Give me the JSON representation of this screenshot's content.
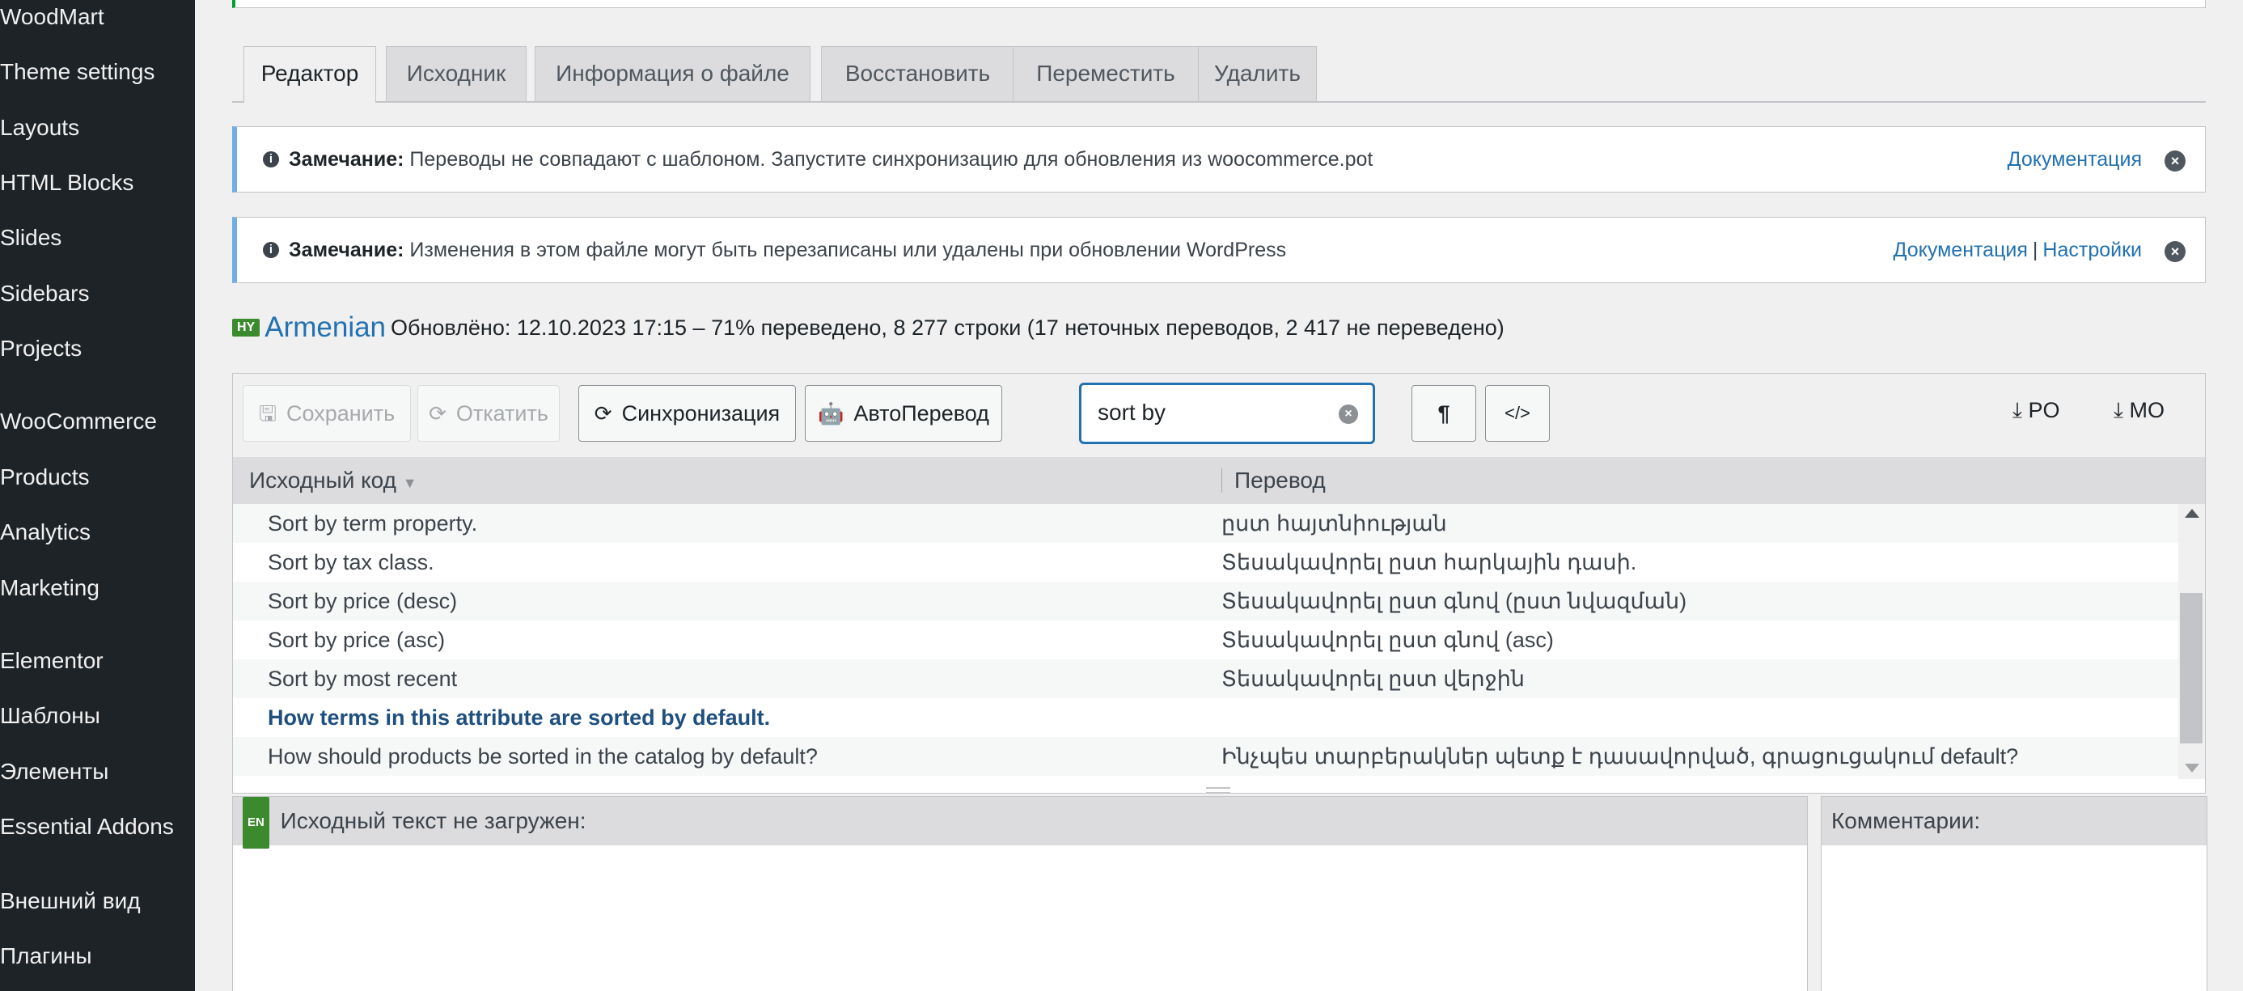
{
  "sidebar": {
    "items": [
      {
        "label": "WoodMart"
      },
      {
        "label": "Theme settings"
      },
      {
        "label": "Layouts"
      },
      {
        "label": "HTML Blocks"
      },
      {
        "label": "Slides"
      },
      {
        "label": "Sidebars"
      },
      {
        "label": "Projects"
      },
      {
        "label": "WooCommerce"
      },
      {
        "label": "Products"
      },
      {
        "label": "Analytics"
      },
      {
        "label": "Marketing"
      },
      {
        "label": "Elementor"
      },
      {
        "label": "Шаблоны"
      },
      {
        "label": "Элементы"
      },
      {
        "label": "Essential Addons"
      },
      {
        "label": "Внешний вид"
      },
      {
        "label": "Плагины"
      }
    ]
  },
  "tabs": [
    {
      "label": "Редактор",
      "active": true
    },
    {
      "label": "Исходник"
    },
    {
      "label": "Информация о файле"
    },
    {
      "label": "Восстановить"
    },
    {
      "label": "Переместить"
    },
    {
      "label": "Удалить"
    }
  ],
  "notices": [
    {
      "prefix": "Замечание:",
      "text": "Переводы не совпадают с шаблоном. Запустите синхронизацию для обновления из woocommerce.pot",
      "link1": "Документация"
    },
    {
      "prefix": "Замечание:",
      "text": "Изменения в этом файле могут быть перезаписаны или удалены при обновлении WordPress",
      "link1": "Документация",
      "separator": "|",
      "link2": "Настройки"
    }
  ],
  "locale": {
    "flag": "HY",
    "name": "Armenian",
    "stats": "Обновлёно: 12.10.2023 17:15 – 71% переведено, 8 277 строки (17 неточных переводов, 2 417 не переведено)"
  },
  "toolbar": {
    "save": "Сохранить",
    "revert": "Откатить",
    "sync": "Синхронизация",
    "autotranslate": "АвтоПеревод",
    "search_value": "sort by",
    "pilcrow": "¶",
    "code": "</>",
    "po": "PO",
    "mo": "MO"
  },
  "table": {
    "col_source": "Исходный код",
    "col_translation": "Перевод",
    "rows": [
      {
        "source": "Sort by term property.",
        "translation": "ըստ հայտնիության"
      },
      {
        "source": "Sort by tax class.",
        "translation": "Տեսակավորել ըստ հարկային դասի."
      },
      {
        "source": "Sort by price (desc)",
        "translation": "Տեսակավորել ըստ գնով (ըստ նվազման)"
      },
      {
        "source": "Sort by price (asc)",
        "translation": "Տեսակավորել ըստ գնով (asc)"
      },
      {
        "source": "Sort by most recent",
        "translation": "Տեսակավորել ըստ վերջին"
      },
      {
        "source": "How terms in this attribute are sorted by default.",
        "translation": ""
      },
      {
        "source": "How should products be sorted in the catalog by default?",
        "translation": "Ինչպես տարբերակներ պետք է դասավորված, գրացուցակում default?"
      }
    ]
  },
  "source_pane": {
    "flag": "EN",
    "title": "Исходный текст не загружен:"
  },
  "comments_pane": {
    "title": "Комментарии:"
  },
  "colors": {
    "sidebar_bg": "#1d2327",
    "link": "#2271b1",
    "notice_border": "#72aee6",
    "flag_bg": "#3c8a2e"
  }
}
